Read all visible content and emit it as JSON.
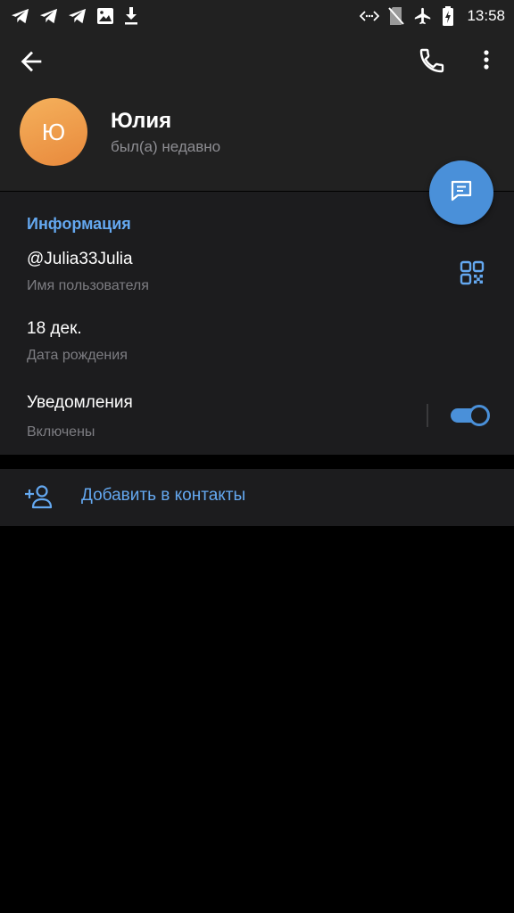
{
  "status_bar": {
    "time": "13:58",
    "left_icons": [
      "telegram-icon",
      "telegram-icon",
      "telegram-icon",
      "image-icon",
      "download-icon"
    ],
    "right_icons": [
      "data-sync-icon",
      "no-sim-icon",
      "airplane-icon",
      "battery-charging-icon"
    ]
  },
  "header": {
    "avatar_initial": "Ю",
    "name": "Юлия",
    "last_seen": "был(а) недавно"
  },
  "info": {
    "section_title": "Информация",
    "username": "@Julia33Julia",
    "username_label": "Имя пользователя",
    "birthday": "18 дек.",
    "birthday_label": "Дата рождения",
    "notifications": "Уведомления",
    "notifications_status": "Включены",
    "notifications_enabled": true
  },
  "actions": {
    "add_contact": "Добавить в контакты"
  },
  "colors": {
    "accent": "#4a90d9",
    "link": "#64a8f0",
    "avatar_gradient_start": "#f5b15c",
    "avatar_gradient_end": "#e8893c",
    "header_bg": "#212121",
    "section_bg": "#1c1c1e"
  }
}
